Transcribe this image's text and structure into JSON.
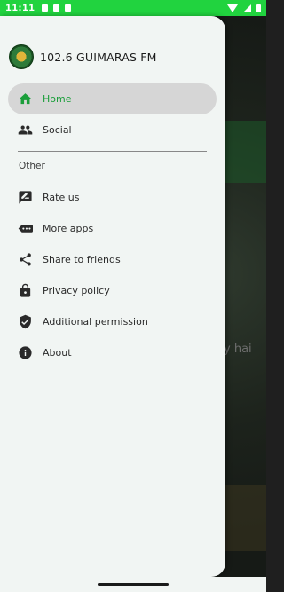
{
  "status_bar": {
    "time": "11:11"
  },
  "background": {
    "partial_text": "y hai"
  },
  "drawer": {
    "title": "102.6 GUIMARAS FM",
    "primary_items": [
      {
        "label": "Home",
        "icon": "home-icon",
        "active": true
      },
      {
        "label": "Social",
        "icon": "people-icon",
        "active": false
      }
    ],
    "section_label": "Other",
    "other_items": [
      {
        "label": "Rate us",
        "icon": "rate-icon"
      },
      {
        "label": "More apps",
        "icon": "more-apps-icon"
      },
      {
        "label": "Share to friends",
        "icon": "share-icon"
      },
      {
        "label": "Privacy policy",
        "icon": "lock-icon"
      },
      {
        "label": "Additional permission",
        "icon": "shield-check-icon"
      },
      {
        "label": "About",
        "icon": "info-icon"
      }
    ]
  },
  "colors": {
    "accent": "#1a9e3a",
    "status_bar": "#21d33f",
    "drawer_bg": "#f1f5f3"
  }
}
